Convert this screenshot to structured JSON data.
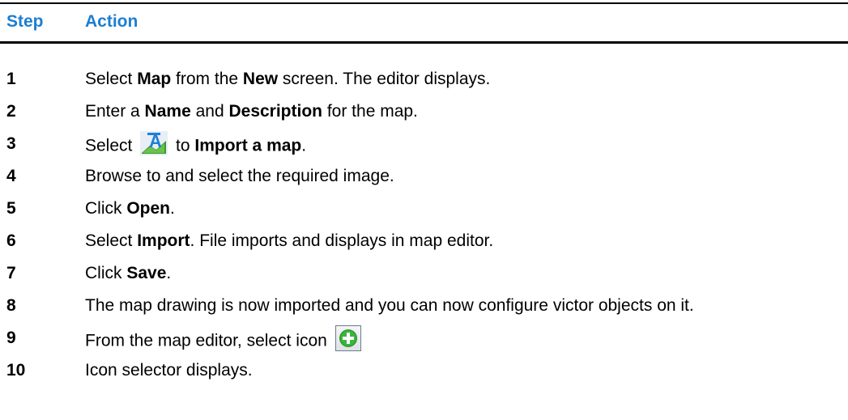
{
  "table": {
    "header": {
      "step_label": "Step",
      "action_label": "Action"
    },
    "colors": {
      "header_text": "#1b7fd1",
      "rule": "#000000",
      "import_icon_blue": "#1e7fd6",
      "import_icon_green": "#3a9b2f",
      "add_icon_green": "#3cb43c"
    },
    "steps": [
      {
        "num": "1",
        "parts": [
          "Select ",
          "Map",
          " from the ",
          "New",
          " screen. The editor displays."
        ]
      },
      {
        "num": "2",
        "parts": [
          "Enter a ",
          "Name",
          " and ",
          "Description",
          " for the map."
        ]
      },
      {
        "num": "3",
        "parts": [
          "Select ",
          " to ",
          "Import a map",
          "."
        ],
        "icon": "import-map-icon"
      },
      {
        "num": "4",
        "parts": [
          "Browse to and select the required image."
        ]
      },
      {
        "num": "5",
        "parts": [
          "Click ",
          "Open",
          "."
        ]
      },
      {
        "num": "6",
        "parts": [
          "Select ",
          "Import",
          ". File imports and displays in map editor."
        ]
      },
      {
        "num": "7",
        "parts": [
          "Click ",
          "Save",
          "."
        ]
      },
      {
        "num": "8",
        "parts": [
          "The map drawing is now imported and you can now configure victor objects on it."
        ]
      },
      {
        "num": "9",
        "parts": [
          "From the map editor, select icon "
        ],
        "icon": "add-icon"
      },
      {
        "num": "10",
        "parts": [
          "Icon selector displays."
        ]
      }
    ]
  }
}
